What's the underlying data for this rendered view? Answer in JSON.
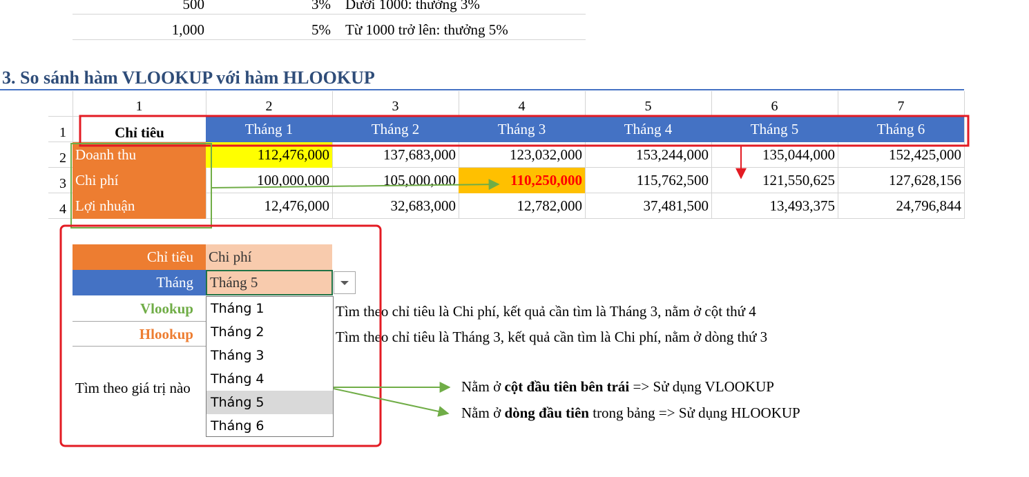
{
  "top_rows": [
    {
      "amount": "500",
      "rate": "3%",
      "desc": "Dưới 1000: thưởng 3%"
    },
    {
      "amount": "1,000",
      "rate": "5%",
      "desc": "Từ 1000 trở lên: thưởng 5%"
    }
  ],
  "section_title": "3. So sánh hàm VLOOKUP với hàm HLOOKUP",
  "col_index": [
    "1",
    "2",
    "3",
    "4",
    "5",
    "6",
    "7"
  ],
  "row_index": [
    "1",
    "2",
    "3",
    "4"
  ],
  "table": {
    "header": [
      "Chỉ tiêu",
      "Tháng 1",
      "Tháng 2",
      "Tháng 3",
      "Tháng 4",
      "Tháng 5",
      "Tháng 6"
    ],
    "rows": [
      {
        "label": "Doanh thu",
        "values": [
          "112,476,000",
          "137,683,000",
          "123,032,000",
          "153,244,000",
          "135,044,000",
          "152,425,000"
        ]
      },
      {
        "label": "Chi phí",
        "values": [
          "100,000,000",
          "105,000,000",
          "110,250,000",
          "115,762,500",
          "121,550,625",
          "127,628,156"
        ]
      },
      {
        "label": "Lợi nhuận",
        "values": [
          "12,476,000",
          "32,683,000",
          "12,782,000",
          "37,481,500",
          "13,493,375",
          "24,796,844"
        ]
      }
    ]
  },
  "lookup": {
    "chitieu_label": "Chỉ tiêu",
    "chitieu_value": "Chi phí",
    "thang_label": "Tháng",
    "thang_value": "Tháng 5",
    "vlookup_label": "Vlookup",
    "hlookup_label": "Hlookup",
    "vlookup_desc": "Tìm theo chỉ tiêu là Chi phí, kết quả cần tìm là Tháng 3, nằm ở cột thứ 4",
    "hlookup_desc": "Tìm theo chỉ tiêu là Tháng 3, kết quả cần tìm là Chi phí, nằm ở dòng thứ 3",
    "question": "Tìm theo giá trị nào"
  },
  "dropdown": {
    "options": [
      "Tháng 1",
      "Tháng 2",
      "Tháng 3",
      "Tháng 4",
      "Tháng 5",
      "Tháng 6"
    ],
    "highlighted": "Tháng 5"
  },
  "notes": {
    "n1_pre": "Nằm ở ",
    "n1_bold": "cột đầu tiên bên trái",
    "n1_post": " => Sử dụng VLOOKUP",
    "n2_pre": "Nằm ở ",
    "n2_bold": "dòng đầu tiên",
    "n2_post": " trong bảng => Sử dụng HLOOKUP"
  },
  "colors": {
    "header_blue": "#4472c4",
    "orange": "#ed7d31",
    "peach": "#f8cbad",
    "yellow": "#ffff00",
    "gold": "#ffc000",
    "annotation_red": "#e31b23",
    "annotation_green": "#70ad47"
  }
}
